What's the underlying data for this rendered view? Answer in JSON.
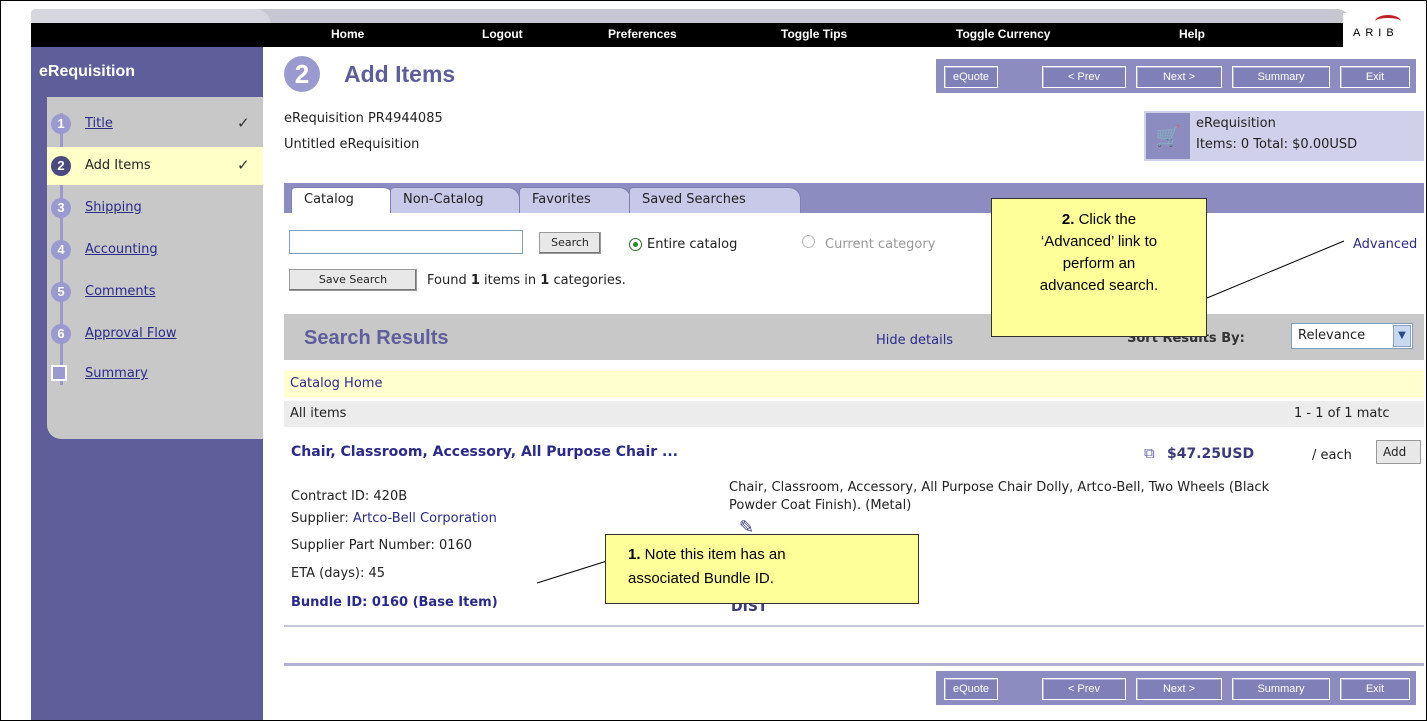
{
  "nav": {
    "items": [
      "Home",
      "Logout",
      "Preferences",
      "Toggle Tips",
      "Toggle Currency",
      "Help"
    ],
    "logo_text": "ARIB"
  },
  "sidebar": {
    "title": "eRequisition",
    "steps": [
      {
        "num": "1",
        "label": "Title",
        "done": "✓"
      },
      {
        "num": "2",
        "label": "Add Items",
        "done": "✓"
      },
      {
        "num": "3",
        "label": "Shipping",
        "done": ""
      },
      {
        "num": "4",
        "label": "Accounting",
        "done": ""
      },
      {
        "num": "5",
        "label": "Comments",
        "done": ""
      },
      {
        "num": "6",
        "label": "Approval Flow",
        "done": ""
      },
      {
        "num": "",
        "label": "Summary",
        "done": ""
      }
    ]
  },
  "header": {
    "step_num": "2",
    "title": "Add Items"
  },
  "actions": {
    "equote": "eQuote",
    "prev": "< Prev",
    "next": "Next >",
    "summary": "Summary",
    "exit": "Exit"
  },
  "requisition": {
    "id_line": "eRequisition PR4944085",
    "name": "Untitled eRequisition"
  },
  "cart": {
    "label": "eRequisition",
    "summary": "Items: 0  Total: $0.00USD"
  },
  "tabs": [
    "Catalog",
    "Non-Catalog",
    "Favorites",
    "Saved Searches"
  ],
  "search": {
    "value": "",
    "button": "Search",
    "scope_entire": "Entire catalog",
    "scope_current": "Current category",
    "advanced": "Advanced",
    "save_button": "Save Search",
    "found_prefix": "Found ",
    "found_items": "1",
    "found_mid": " items in ",
    "found_categories": "1",
    "found_suffix": " categories."
  },
  "results": {
    "title": "Search Results",
    "hide_details": "Hide details",
    "sort_label": "Sort Results By:",
    "sort_value": "Relevance",
    "breadcrumb": "Catalog Home",
    "all_items": "All items",
    "range": "1 - 1 of 1 matc",
    "item": {
      "name": "Chair, Classroom, Accessory, All Purpose Chair ...",
      "price": "$47.25USD",
      "unit": "/ each",
      "add": "Add",
      "contract_label": "Contract ID:  420B",
      "supplier_label": "Supplier:  ",
      "supplier": "Artco-Bell Corporation",
      "part_number": "Supplier Part Number:  0160",
      "eta": "ETA (days):  45",
      "bundle": "Bundle ID: 0160 (Base Item)",
      "description_1": "Chair, Classroom, Accessory, All Purpose Chair Dolly, Artco-Bell, Two Wheels (Black",
      "description_2": "Powder Coat Finish). (Metal)",
      "dist": "DIST"
    }
  },
  "callouts": {
    "one_num": "1.",
    "one_line1": " Note this item has an",
    "one_line2": "associated Bundle ID.",
    "two_num": "2.",
    "two_line1": " Click the",
    "two_line2": "‘Advanced’ link to",
    "two_line3": "perform an",
    "two_line4": "advanced search."
  }
}
